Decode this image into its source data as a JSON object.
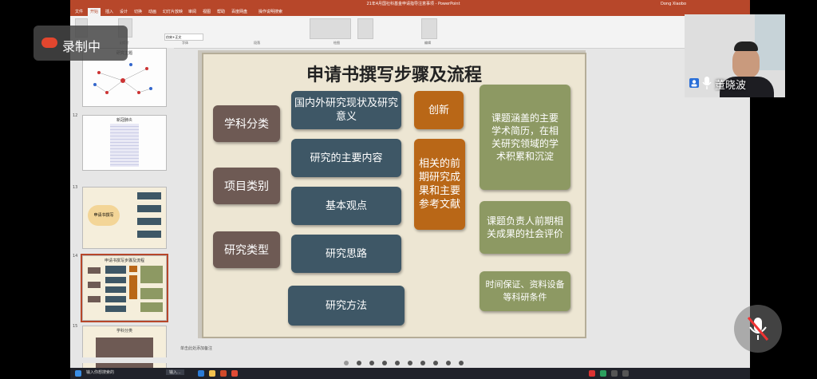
{
  "app": {
    "window_title": "21年4月国社科基金申请指导注意事项 - PowerPoint",
    "user": "Dong Xiaobo",
    "tabs": [
      "文件",
      "开始",
      "插入",
      "设计",
      "切换",
      "动画",
      "幻灯片放映",
      "审阅",
      "视图",
      "帮助",
      "百度网盘",
      "操作说明搜索"
    ],
    "active_tab": "开始",
    "ribbon_groups": [
      "剪贴板",
      "幻灯片",
      "字体",
      "段落",
      "绘图",
      "编辑"
    ],
    "font_name": "仿宋+正文"
  },
  "recording": {
    "label": "录制中"
  },
  "participant": {
    "name": "董晓波"
  },
  "thumbnails": [
    {
      "num": "",
      "title": "研究主题"
    },
    {
      "num": "12",
      "title": "新冠肺炎"
    },
    {
      "num": "13",
      "title": "申请书撰写"
    },
    {
      "num": "14",
      "title": "申请书撰写步骤及流程"
    },
    {
      "num": "15",
      "title": "学科分类"
    }
  ],
  "slide": {
    "title": "申请书撰写步骤及流程",
    "left_boxes": [
      "学科分类",
      "项目类别",
      "研究类型"
    ],
    "middle_boxes": [
      "国内外研究现状及研究意义",
      "研究的主要内容",
      "基本观点",
      "研究思路",
      "研究方法"
    ],
    "innovation": "创新",
    "prior_research": "相关的前期研究成果和主要参考文献",
    "right_boxes": [
      "课题涵盖的主要学术简历，在相关研究领域的学术积累和沉淀",
      "课题负责人前期相关成果的社会评价",
      "时间保证、资料设备等科研条件"
    ]
  },
  "notes_placeholder": "单击此处添加备注",
  "taskbar": {
    "search": "输入你想搜索的",
    "window": "输入..."
  },
  "colors": {
    "accent": "#b7472a",
    "brown": "#6e5a54",
    "slate": "#3e5766",
    "orange": "#b96717",
    "olive": "#8d9963"
  }
}
